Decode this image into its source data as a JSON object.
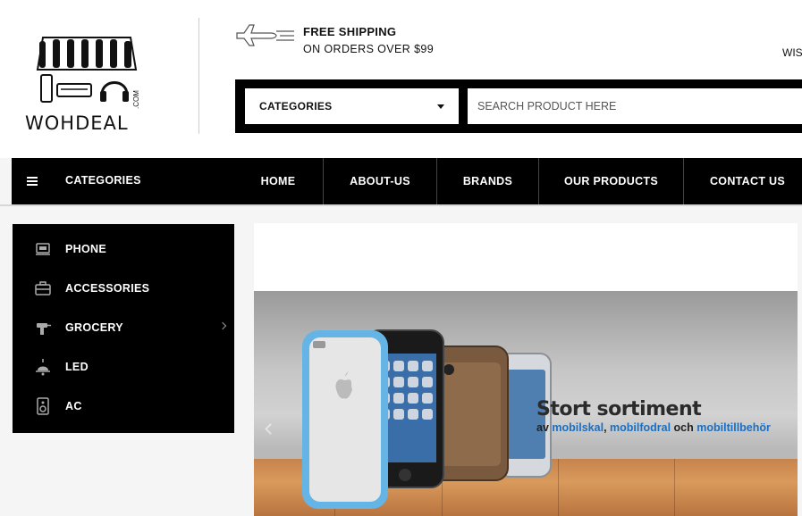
{
  "logo": {
    "text": "WOHDEAL",
    "suffix": ".COM"
  },
  "shipping": {
    "title": "FREE SHIPPING",
    "subtitle": "ON ORDERS OVER $99",
    "icon": "airplane-icon"
  },
  "header_right": {
    "wishlist_label": "WIS"
  },
  "search": {
    "category_label": "CATEGORIES",
    "placeholder": "SEARCH PRODUCT HERE"
  },
  "nav": {
    "categories_label": "CATEGORIES",
    "items": [
      {
        "label": "HOME"
      },
      {
        "label": "ABOUT-US"
      },
      {
        "label": "BRANDS"
      },
      {
        "label": "OUR PRODUCTS"
      },
      {
        "label": "CONTACT US"
      }
    ]
  },
  "sidebar": {
    "items": [
      {
        "label": "PHONE",
        "icon": "phone-icon"
      },
      {
        "label": "ACCESSORIES",
        "icon": "briefcase-icon"
      },
      {
        "label": "GROCERY",
        "icon": "drill-icon",
        "has_submenu": true
      },
      {
        "label": "LED",
        "icon": "lamp-icon"
      },
      {
        "label": "AC",
        "icon": "speaker-icon"
      }
    ]
  },
  "banner": {
    "headline": "Stort sortiment",
    "sub_prefix": "av ",
    "sub_hl1": "mobilskal",
    "sub_sep1": ", ",
    "sub_hl2": "mobilfodral",
    "sub_mid": " och ",
    "sub_hl3": "mobiltillbehör"
  },
  "colors": {
    "nav_bg": "#000000",
    "accent_link": "#1b6fc2"
  }
}
